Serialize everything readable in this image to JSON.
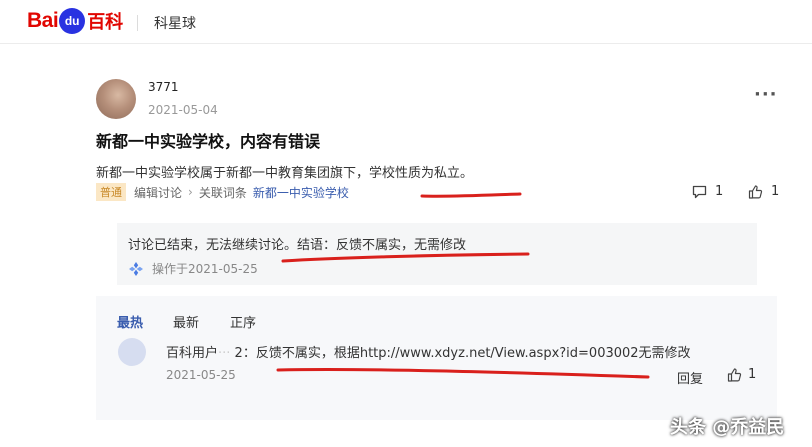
{
  "header": {
    "logo_bai": "Bai",
    "logo_du": "du",
    "logo_baike": "百科",
    "title": "科星球"
  },
  "post": {
    "username": "3771",
    "date": "2021-05-04",
    "title": "新都一中实验学校，内容有错误",
    "body": "新都一中实验学校属于新都一中教育集团旗下，学校性质为私立。",
    "tag": "普通",
    "edit_link": "编辑讨论",
    "related_label": "关联词条",
    "entry_link": "新都一中实验学校",
    "comment_count": "1",
    "like_count": "1"
  },
  "conclusion": {
    "text": "讨论已结束，无法继续讨论。结语：反馈不属实，无需修改",
    "operated": "操作于2021-05-25"
  },
  "sort_tabs": [
    "最热",
    "最新",
    "正序"
  ],
  "comment": {
    "user": "百科用户",
    "user_suffix": "2",
    "text": "：反馈不属实，根据http://www.xdyz.net/View.aspx?id=003002无需修改",
    "date": "2021-05-25",
    "reply": "回复",
    "likes": "1"
  },
  "watermark": "头条 @乔益民",
  "colors": {
    "brand_red": "#e10601",
    "brand_blue": "#2932e1",
    "link_blue": "#3a5dae",
    "annotation_red": "#d9201c"
  }
}
